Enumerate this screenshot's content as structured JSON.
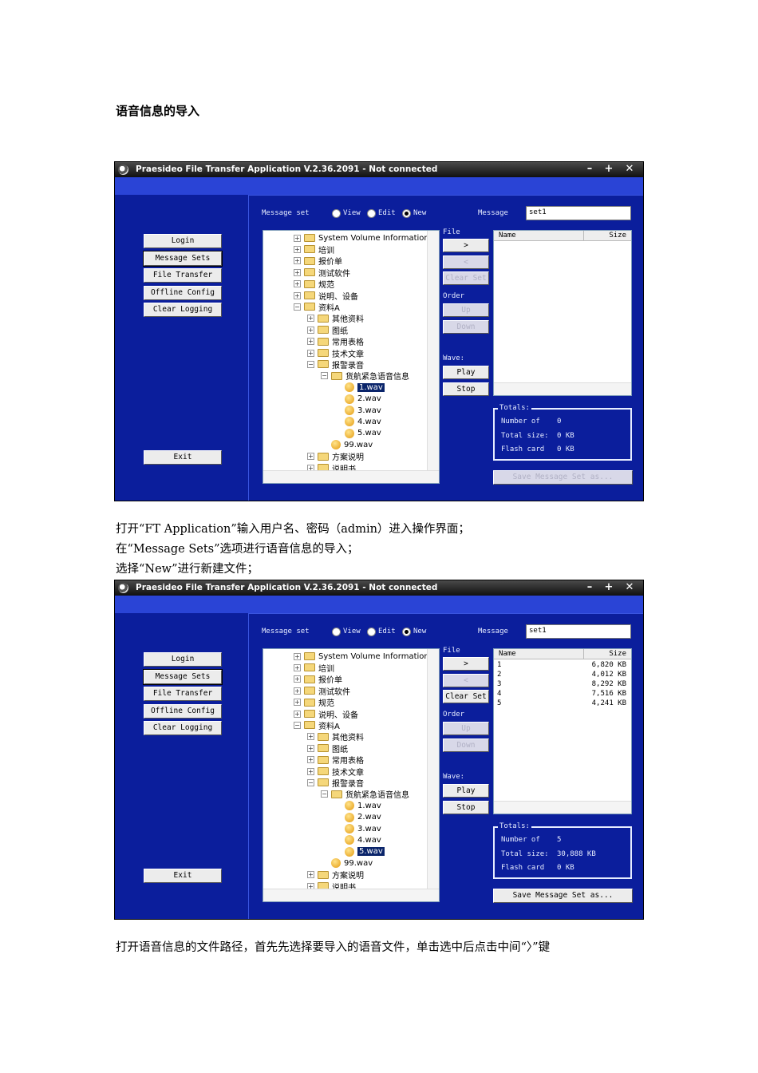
{
  "doc": {
    "heading": "语音信息的导入",
    "para1": "打开“FT Application”输入用户名、密码（admin）进入操作界面；",
    "para2": "在“Message Sets”选项进行语音信息的导入；",
    "para3": "选择“New”进行新建文件；",
    "para4": "打开语音信息的文件路径，首先先选择要导入的语音文件，单击选中后点击中间“〉”键"
  },
  "window": {
    "title": "Praesideo File Transfer Application V.2.36.2091 - Not connected",
    "min": "–",
    "max": "+",
    "close": "✕"
  },
  "left_buttons": [
    "Login",
    "Message Sets",
    "File Transfer",
    "Offline Config",
    "Clear Logging"
  ],
  "exit_label": "Exit",
  "message_set_label": "Message set",
  "modes": [
    "View",
    "Edit",
    "New"
  ],
  "selected_mode": "New",
  "message_label": "Message",
  "message_value": "set1",
  "files_label": "File",
  "order_label": "Order",
  "wave_label": "Wave:",
  "buttons": {
    "add": ">",
    "remove": "<",
    "clear_set": "Clear Set",
    "up": "Up",
    "down": "Down",
    "play": "Play",
    "stop": "Stop",
    "save": "Save Message Set as..."
  },
  "tree": [
    {
      "indent": 0,
      "pm": "+",
      "icon": "folder",
      "label": "System Volume Information"
    },
    {
      "indent": 0,
      "pm": "+",
      "icon": "folder",
      "label": "培训"
    },
    {
      "indent": 0,
      "pm": "+",
      "icon": "folder",
      "label": "报价单"
    },
    {
      "indent": 0,
      "pm": "+",
      "icon": "folder",
      "label": "测试软件"
    },
    {
      "indent": 0,
      "pm": "+",
      "icon": "folder",
      "label": "规范"
    },
    {
      "indent": 0,
      "pm": "+",
      "icon": "folder",
      "label": "说明、设备"
    },
    {
      "indent": 0,
      "pm": "−",
      "icon": "folder",
      "label": "资料A"
    },
    {
      "indent": 1,
      "pm": "+",
      "icon": "folder",
      "label": "其他资料"
    },
    {
      "indent": 1,
      "pm": "+",
      "icon": "folder",
      "label": "图纸"
    },
    {
      "indent": 1,
      "pm": "+",
      "icon": "folder",
      "label": "常用表格"
    },
    {
      "indent": 1,
      "pm": "+",
      "icon": "folder",
      "label": "技术文章"
    },
    {
      "indent": 1,
      "pm": "−",
      "icon": "folder",
      "label": "报警录音"
    },
    {
      "indent": 2,
      "pm": "−",
      "icon": "folder",
      "label": "货航紧急语音信息"
    },
    {
      "indent": 3,
      "pm": "",
      "icon": "wav",
      "label": "1.wav"
    },
    {
      "indent": 3,
      "pm": "",
      "icon": "wav",
      "label": "2.wav"
    },
    {
      "indent": 3,
      "pm": "",
      "icon": "wav",
      "label": "3.wav"
    },
    {
      "indent": 3,
      "pm": "",
      "icon": "wav",
      "label": "4.wav"
    },
    {
      "indent": 3,
      "pm": "",
      "icon": "wav",
      "label": "5.wav"
    },
    {
      "indent": 2,
      "pm": "",
      "icon": "wav",
      "label": "99.wav"
    },
    {
      "indent": 1,
      "pm": "+",
      "icon": "folder",
      "label": "方案说明"
    },
    {
      "indent": 1,
      "pm": "+",
      "icon": "folder",
      "label": "说明书"
    }
  ],
  "list_headers": {
    "name": "Name",
    "size": "Size"
  },
  "totals_label": "Totals:",
  "totals_keys": {
    "number": "Number of",
    "total_size": "Total size:",
    "flash": "Flash card"
  },
  "screens": [
    {
      "selected_tree_row": 13,
      "list_rows": [],
      "totals": {
        "number": "0",
        "total_size": "0 KB",
        "flash": "0 KB"
      },
      "clear_enabled": false,
      "save_enabled": false
    },
    {
      "selected_tree_row": 17,
      "list_rows": [
        {
          "name": "1",
          "size": "6,820 KB"
        },
        {
          "name": "2",
          "size": "4,012 KB"
        },
        {
          "name": "3",
          "size": "8,292 KB"
        },
        {
          "name": "4",
          "size": "7,516 KB"
        },
        {
          "name": "5",
          "size": "4,241 KB"
        }
      ],
      "totals": {
        "number": "5",
        "total_size": "30,888 KB",
        "flash": "0 KB"
      },
      "clear_enabled": true,
      "save_enabled": true
    }
  ]
}
